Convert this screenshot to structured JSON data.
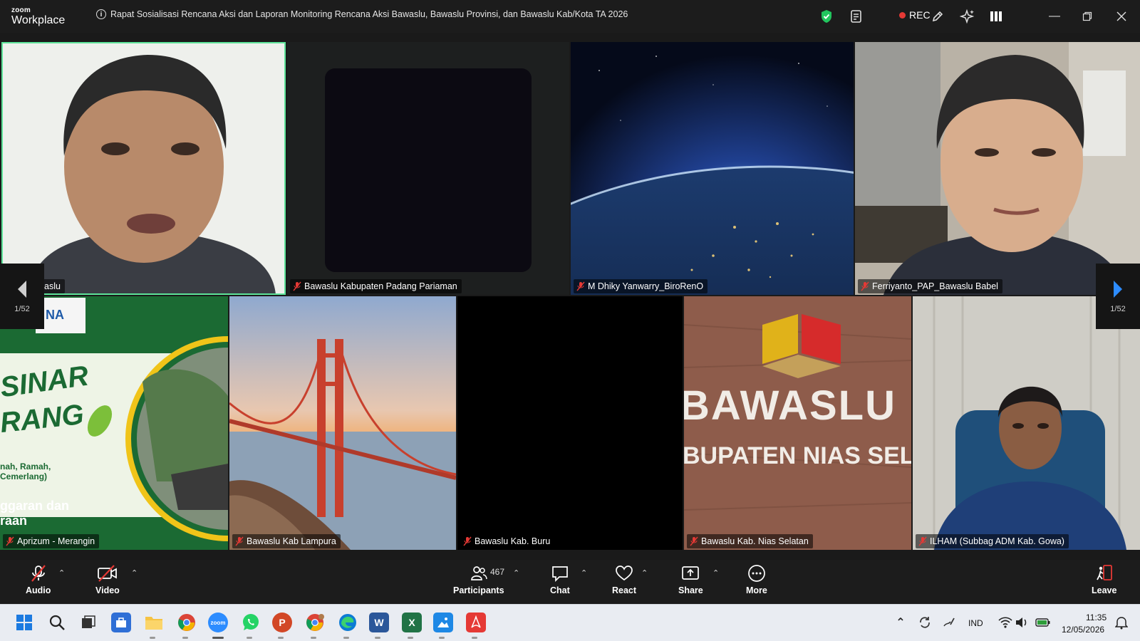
{
  "app": {
    "brand_top": "zoom",
    "brand_bottom": "Workplace",
    "meeting_title": "Rapat Sosialisasi Rencana Aksi dan Laporan Monitoring Rencana Aksi Bawaslu, Bawaslu Provinsi, dan Bawaslu Kab/Kota TA 2026",
    "rec_label": "REC"
  },
  "participants": [
    {
      "name": "Bawaslu",
      "display": "aslu",
      "muted": false
    },
    {
      "name": "Bawaslu Kabupaten Padang Pariaman",
      "muted": true
    },
    {
      "name": "M Dhiky Yanwarry_BiroRenO",
      "muted": true
    },
    {
      "name": "Ferriyanto_PAP_Bawaslu Babel",
      "muted": true
    },
    {
      "name": "Aprizum - Merangin",
      "muted": true
    },
    {
      "name": "Bawaslu Kab Lampura",
      "muted": true
    },
    {
      "name": "Bawaslu Kab. Buru",
      "muted": true
    },
    {
      "name": "Bawaslu Kab. Nias Selatan",
      "muted": true
    },
    {
      "name": "ILHAM (Subbag ADM Kab. Gowa)",
      "muted": true
    }
  ],
  "backgrounds": {
    "sinar_lines": [
      "SINAR",
      "RANG",
      "nah, Ramah,",
      "Cemerlang)",
      "ggaran dan",
      "raan"
    ],
    "sinar_logo": "NA",
    "bawaslu_main": "BAWASLU",
    "bawaslu_sub": "BUPATEN NIAS SELAT"
  },
  "pagination": {
    "left": "1/52",
    "right": "1/52"
  },
  "toolbar": {
    "audio": "Audio",
    "video": "Video",
    "participants": "Participants",
    "participants_count": "467",
    "chat": "Chat",
    "react": "React",
    "share": "Share",
    "more": "More",
    "leave": "Leave"
  },
  "taskbar": {
    "language": "IND",
    "time": "11:35",
    "date": "12/05/2026"
  },
  "colors": {
    "active_speaker": "#5ee49a",
    "rec": "#e53935",
    "shield": "#22c55e",
    "nav_arrow": "#2d8cff"
  }
}
